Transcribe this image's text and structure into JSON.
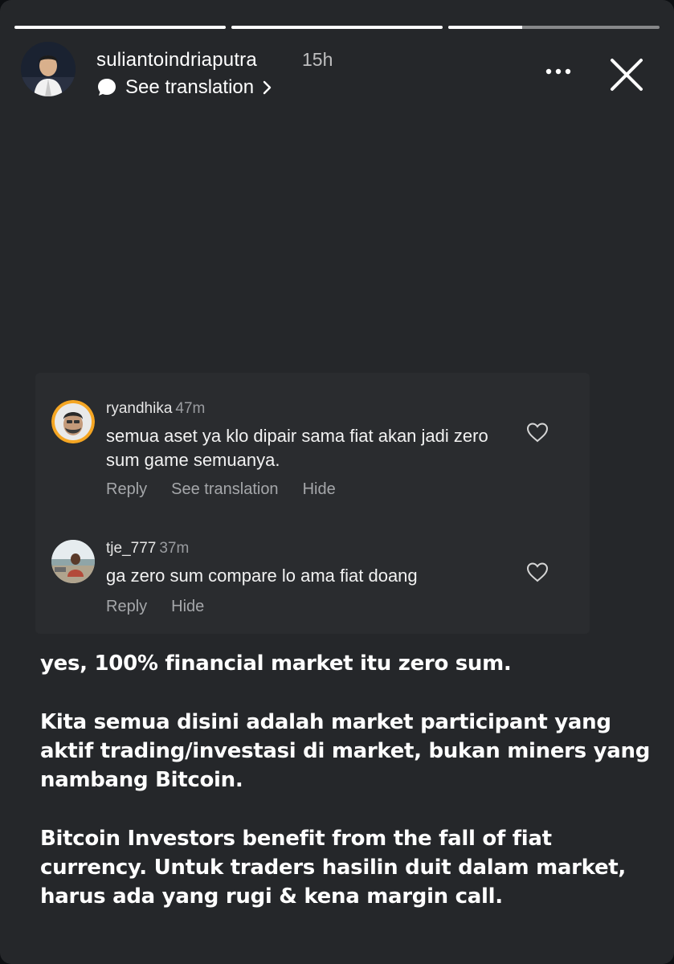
{
  "story": {
    "progress_segments": [
      1,
      1,
      0.35
    ],
    "header": {
      "username": "suliantoindriaputra",
      "time_ago": "15h",
      "see_translation": "See translation",
      "avatar_icon": "profile-photo",
      "more_icon": "more-horizontal-icon",
      "close_icon": "close-icon"
    }
  },
  "comments": [
    {
      "username": "ryandhika",
      "time": "47m",
      "text": "semua aset ya klo dipair sama fiat akan jadi zero sum game semuanya.",
      "actions": [
        "Reply",
        "See translation",
        "Hide"
      ]
    },
    {
      "username": "tje_777",
      "time": "37m",
      "text": "ga zero sum compare lo ama fiat doang",
      "actions": [
        "Reply",
        "Hide"
      ]
    }
  ],
  "caption": [
    "yes, 100% financial market itu zero sum.",
    "Kita semua disini adalah market participant yang aktif trading/investasi di market, bukan miners yang nambang Bitcoin.",
    "Bitcoin Investors benefit from the fall of fiat currency. Untuk traders hasilin duit dalam market, harus ada yang rugi & kena margin call."
  ],
  "colors": {
    "background": "#25272a",
    "card": "#2a2c2f",
    "ryandhika_avatar_ring": "#f5a623"
  }
}
